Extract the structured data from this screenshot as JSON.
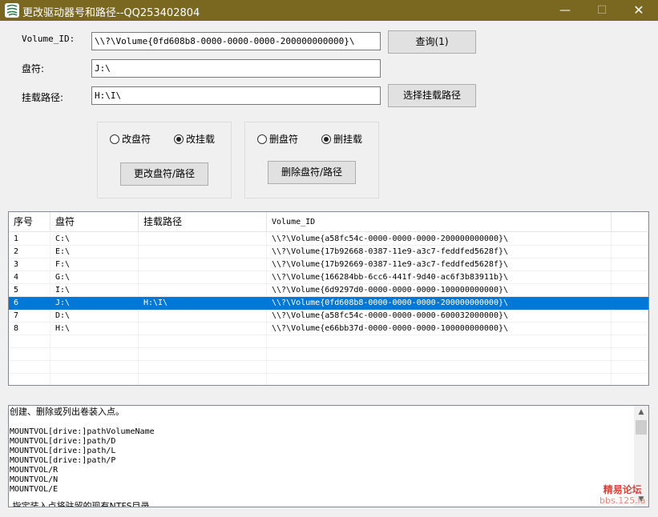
{
  "window": {
    "title": "更改驱动器号和路径--QQ253402804",
    "minimize": "—",
    "maximize": "☐",
    "close": "✕",
    "titlebar_color": "#7a6820"
  },
  "form": {
    "volume_label": "Volume_ID:",
    "volume_value": "\\\\?\\Volume{0fd608b8-0000-0000-0000-200000000000}\\",
    "drive_label": "盘符:",
    "drive_value": "J:\\",
    "mount_label": "挂载路径:",
    "mount_value": "H:\\I\\",
    "query_button": "查询(1)",
    "select_mount_button": "选择挂载路径"
  },
  "change_group": {
    "radio_drive": "改盘符",
    "radio_mount": "改挂载",
    "selected": "改挂载",
    "button": "更改盘符/路径"
  },
  "delete_group": {
    "radio_drive": "删盘符",
    "radio_mount": "删挂载",
    "selected": "删挂载",
    "button": "删除盘符/路径"
  },
  "table": {
    "columns": [
      "序号",
      "盘符",
      "挂载路径",
      "Volume_ID"
    ],
    "rows": [
      {
        "idx": "1",
        "drive": "C:\\",
        "mount": "",
        "volume": "\\\\?\\Volume{a58fc54c-0000-0000-0000-200000000000}\\"
      },
      {
        "idx": "2",
        "drive": "E:\\",
        "mount": "",
        "volume": "\\\\?\\Volume{17b92668-0387-11e9-a3c7-feddfed5628f}\\"
      },
      {
        "idx": "3",
        "drive": "F:\\",
        "mount": "",
        "volume": "\\\\?\\Volume{17b92669-0387-11e9-a3c7-feddfed5628f}\\"
      },
      {
        "idx": "4",
        "drive": "G:\\",
        "mount": "",
        "volume": "\\\\?\\Volume{166284bb-6cc6-441f-9d40-ac6f3b83911b}\\"
      },
      {
        "idx": "5",
        "drive": "I:\\",
        "mount": "",
        "volume": "\\\\?\\Volume{6d9297d0-0000-0000-0000-100000000000}\\"
      },
      {
        "idx": "6",
        "drive": "J:\\",
        "mount": "H:\\I\\",
        "volume": "\\\\?\\Volume{0fd608b8-0000-0000-0000-200000000000}\\"
      },
      {
        "idx": "7",
        "drive": "D:\\",
        "mount": "",
        "volume": "\\\\?\\Volume{a58fc54c-0000-0000-0000-600032000000}\\"
      },
      {
        "idx": "8",
        "drive": "H:\\",
        "mount": "",
        "volume": "\\\\?\\Volume{e66bb37d-0000-0000-0000-100000000000}\\"
      }
    ],
    "selected_index": "6",
    "selection_color": "#0078d7"
  },
  "output": {
    "lines": [
      "创建、删除或列出卷装入点。",
      "",
      "MOUNTVOL[drive:]pathVolumeName",
      "MOUNTVOL[drive:]path/D",
      "MOUNTVOL[drive:]path/L",
      "MOUNTVOL[drive:]path/P",
      "MOUNTVOL/R",
      "MOUNTVOL/N",
      "MOUNTVOL/E",
      "",
      "    ,指定装入点将驻留的现有NTFS目录。"
    ],
    "scroll_up": "▲",
    "scroll_down": "▼"
  },
  "watermark": {
    "line1": "精易论坛",
    "line2": "bbs.125.la"
  }
}
